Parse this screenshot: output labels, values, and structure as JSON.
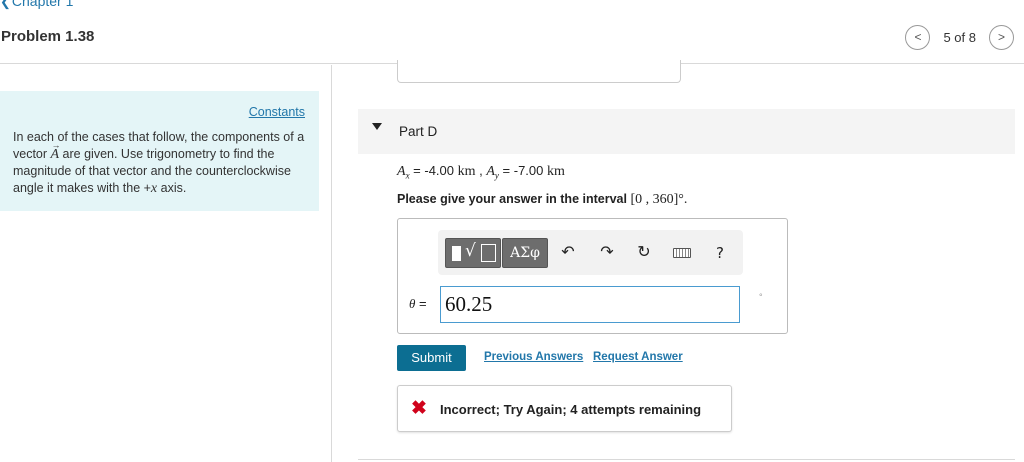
{
  "header": {
    "chapter_link": "Chapter 1",
    "problem_title": "Problem 1.38",
    "pager": {
      "prev_symbol": "<",
      "count": "5 of 8",
      "next_symbol": ">"
    }
  },
  "left": {
    "constants_link": "Constants",
    "text_1": "In each of the cases that follow, the components of a vector ",
    "vector_symbol": "A",
    "text_2": " are given. Use trigonometry to find the magnitude of that vector and the counterclockwise angle it makes with the +",
    "axis_symbol": "x",
    "text_3": " axis."
  },
  "part": {
    "label": "Part D",
    "givens": {
      "ax_symbol": "A",
      "ax_sub": "x",
      "ax_value": " = -4.00 ",
      "unit_1": "km",
      "sep": " , ",
      "ay_symbol": "A",
      "ay_sub": "y",
      "ay_value": " = -7.00 ",
      "unit_2": "km"
    },
    "interval": {
      "text": "Please give your answer in the interval ",
      "range": "[0 , 360]",
      "unit": "°."
    },
    "toolbar": {
      "greek": "ΑΣφ",
      "undo": "↶",
      "redo": "↷",
      "reset": "↻",
      "help": "?"
    },
    "theta_symbol": "θ",
    "theta_eq": " =",
    "answer_value": "60.25",
    "unit_hint": "°",
    "submit": "Submit",
    "previous_answers": "Previous Answers",
    "request_answer": "Request Answer",
    "feedback": {
      "icon": "✖",
      "text": "Incorrect; Try Again; 4 attempts remaining"
    }
  },
  "colors": {
    "accent": "#0c6e92",
    "link": "#2277aa",
    "error": "#d0021b",
    "constants_bg": "#e4f5f7"
  }
}
